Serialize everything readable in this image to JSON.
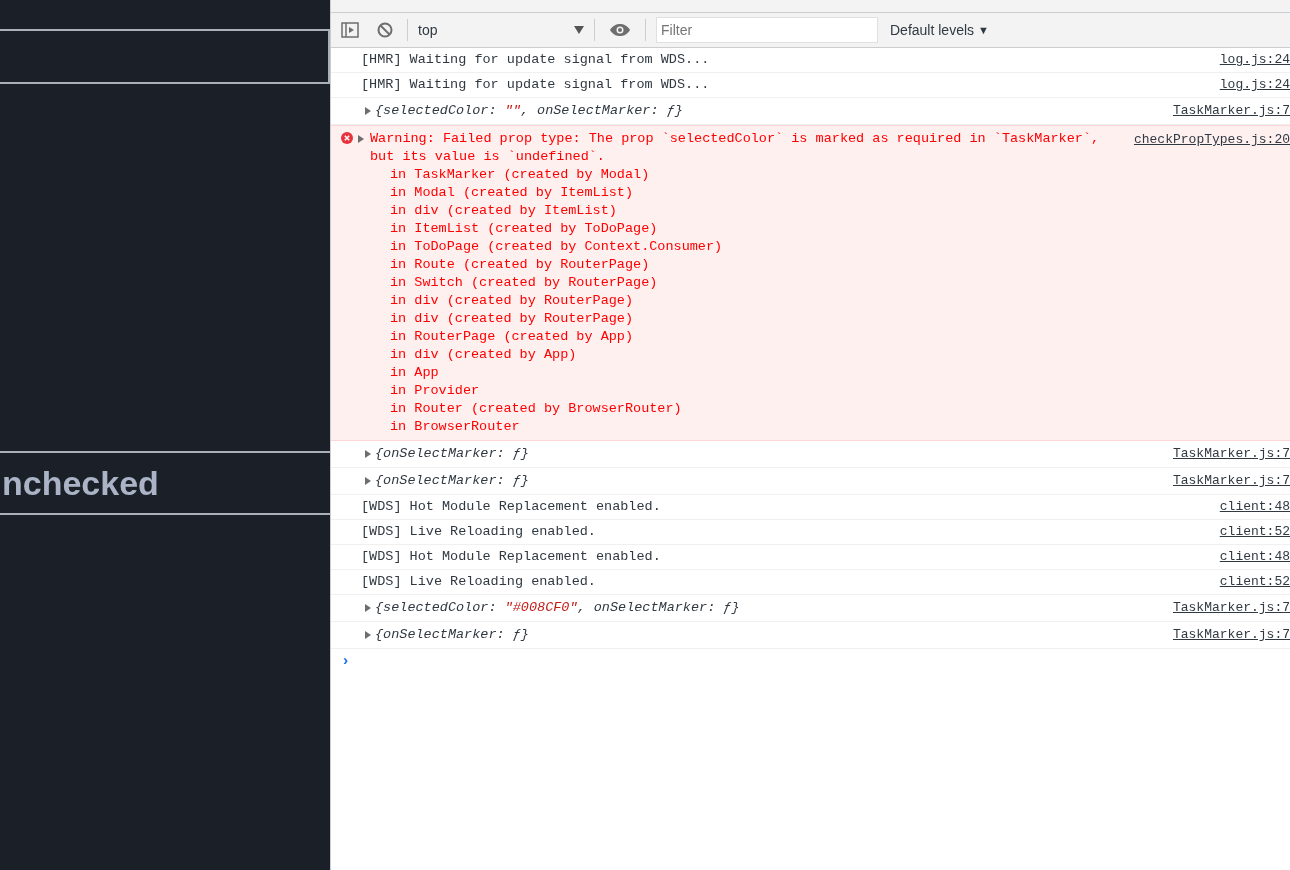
{
  "app": {
    "status_label": "nchecked"
  },
  "toolbar": {
    "context": "top",
    "filter": {
      "placeholder": "Filter"
    },
    "levels": "Default levels",
    "levels_caret": "▼"
  },
  "console": {
    "entries": [
      {
        "kind": "log",
        "text": "[HMR] Waiting for update signal from WDS...",
        "source": "log.js:24"
      },
      {
        "kind": "log",
        "text": "[HMR] Waiting for update signal from WDS...",
        "source": "log.js:24"
      },
      {
        "kind": "object",
        "expanded": false,
        "segments": [
          {
            "kind": "plain",
            "text": "{selectedColor: "
          },
          {
            "kind": "string",
            "text": "\"\""
          },
          {
            "kind": "plain",
            "text": ", onSelectMarker: ƒ}"
          }
        ],
        "source": "TaskMarker.js:7"
      },
      {
        "kind": "error",
        "expanded": false,
        "message": "Warning: Failed prop type: The prop `selectedColor` is marked as required in `TaskMarker`,\nbut its value is `undefined`.",
        "source": "checkPropTypes.js:20",
        "stack": [
          "in TaskMarker (created by Modal)",
          "in Modal (created by ItemList)",
          "in div (created by ItemList)",
          "in ItemList (created by ToDoPage)",
          "in ToDoPage (created by Context.Consumer)",
          "in Route (created by RouterPage)",
          "in Switch (created by RouterPage)",
          "in div (created by RouterPage)",
          "in div (created by RouterPage)",
          "in RouterPage (created by App)",
          "in div (created by App)",
          "in App",
          "in Provider",
          "in Router (created by BrowserRouter)",
          "in BrowserRouter"
        ]
      },
      {
        "kind": "object",
        "expanded": false,
        "segments": [
          {
            "kind": "plain",
            "text": "{onSelectMarker: ƒ}"
          }
        ],
        "source": "TaskMarker.js:7"
      },
      {
        "kind": "object",
        "expanded": false,
        "segments": [
          {
            "kind": "plain",
            "text": "{onSelectMarker: ƒ}"
          }
        ],
        "source": "TaskMarker.js:7"
      },
      {
        "kind": "log",
        "text": "[WDS] Hot Module Replacement enabled.",
        "source": "client:48"
      },
      {
        "kind": "log",
        "text": "[WDS] Live Reloading enabled.",
        "source": "client:52"
      },
      {
        "kind": "log",
        "text": "[WDS] Hot Module Replacement enabled.",
        "source": "client:48"
      },
      {
        "kind": "log",
        "text": "[WDS] Live Reloading enabled.",
        "source": "client:52"
      },
      {
        "kind": "object",
        "expanded": false,
        "segments": [
          {
            "kind": "plain",
            "text": "{selectedColor: "
          },
          {
            "kind": "string",
            "text": "\"#008CF0\""
          },
          {
            "kind": "plain",
            "text": ", onSelectMarker: ƒ}"
          }
        ],
        "source": "TaskMarker.js:7"
      },
      {
        "kind": "object",
        "expanded": false,
        "segments": [
          {
            "kind": "plain",
            "text": "{onSelectMarker: ƒ}"
          }
        ],
        "source": "TaskMarker.js:7"
      }
    ],
    "prompt": "›"
  }
}
